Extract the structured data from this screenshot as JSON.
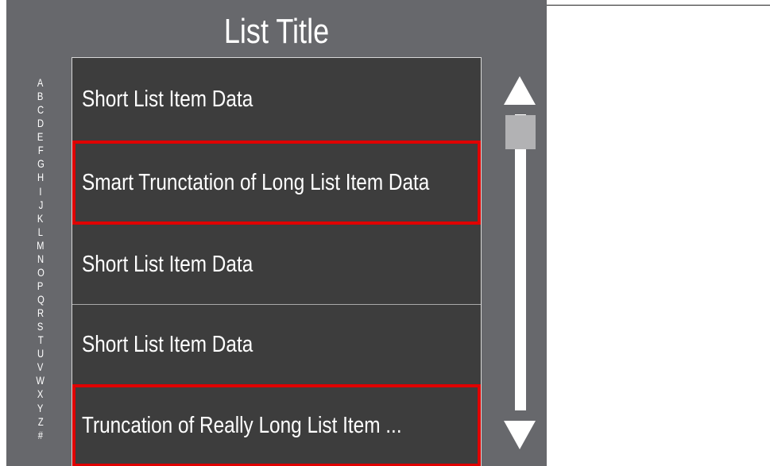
{
  "title": "List Title",
  "alphabet": [
    "A",
    "B",
    "C",
    "D",
    "E",
    "F",
    "G",
    "H",
    "I",
    "J",
    "K",
    "L",
    "M",
    "N",
    "O",
    "P",
    "Q",
    "R",
    "S",
    "T",
    "U",
    "V",
    "W",
    "X",
    "Y",
    "Z",
    "#"
  ],
  "items": [
    {
      "label": "Short List Item Data"
    },
    {
      "label": "Smart Trunctation of Long List Item Data"
    },
    {
      "label": "Short List Item Data"
    },
    {
      "label": "Short List Item Data"
    },
    {
      "label": "Truncation of Really Long List Item ..."
    }
  ],
  "colors": {
    "panel_background": "#67686c",
    "item_background": "#3d3d3d",
    "highlight_outline": "#e00000",
    "scroll_thumb": "#b2b2b4",
    "text": "#ffffff"
  },
  "icons": {
    "scroll_up": "triangle-up-icon",
    "scroll_down": "triangle-down-icon"
  },
  "scroll_position": 0
}
